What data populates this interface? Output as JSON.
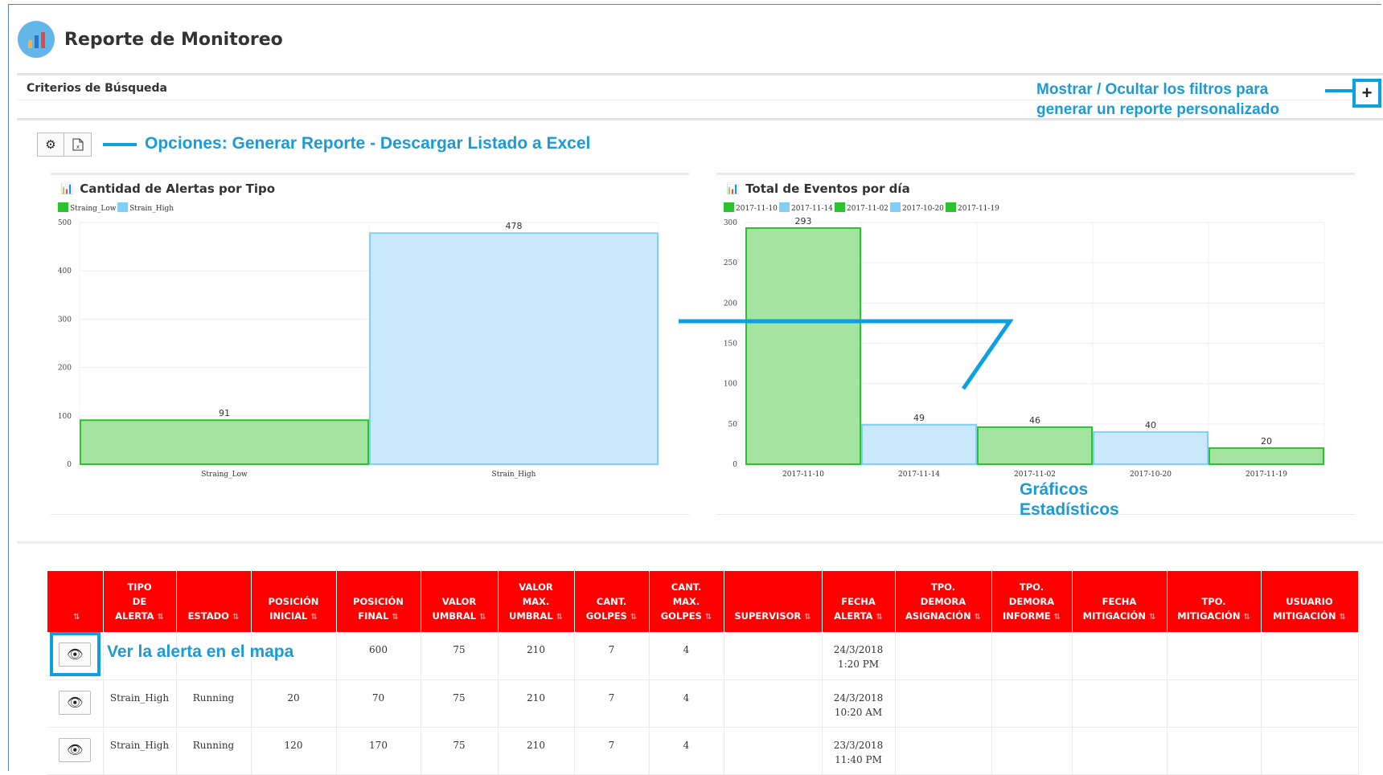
{
  "header": {
    "title": "Reporte de Monitoreo",
    "icon": "bar-chart-icon",
    "icon_color": "#63b6ea"
  },
  "search": {
    "title": "Criterios de Búsqueda",
    "toggle_label": "+"
  },
  "callouts": {
    "filters": [
      "Mostrar / Ocultar los filtros para",
      "generar un reporte personalizado"
    ],
    "options": "Opciones: Generar Reporte - Descargar Listado a Excel",
    "charts": [
      "Gráficos",
      "Estadísticos"
    ],
    "map": "Ver la alerta en el mapa",
    "accent": "#1c9ad6"
  },
  "toolbar": {
    "settings_icon": "gear-icon",
    "excel_icon": "excel-icon"
  },
  "chart_data": [
    {
      "type": "bar",
      "title": "Cantidad de Alertas por Tipo",
      "categories": [
        "Straing_Low",
        "Strain_High"
      ],
      "values": [
        91,
        478
      ],
      "legend": [
        "Straing_Low",
        "Strain_High"
      ],
      "colors": [
        "#a3e4a0",
        "#c9e8fb"
      ],
      "stroke_colors": [
        "#2bc22b",
        "#7fcff7"
      ],
      "ylim": [
        0,
        500
      ],
      "yticks": [
        0,
        100,
        200,
        300,
        400,
        500
      ],
      "legend_placement": "top-left",
      "grid": true
    },
    {
      "type": "bar",
      "title": "Total de Eventos por día",
      "categories": [
        "2017-11-10",
        "2017-11-14",
        "2017-11-02",
        "2017-10-20",
        "2017-11-19"
      ],
      "values": [
        293,
        49,
        46,
        40,
        20
      ],
      "legend": [
        "2017-11-10",
        "2017-11-14",
        "2017-11-02",
        "2017-10-20",
        "2017-11-19"
      ],
      "colors": [
        "#a3e4a0",
        "#c9e8fb",
        "#a3e4a0",
        "#c9e8fb",
        "#a3e4a0"
      ],
      "stroke_colors": [
        "#2bc22b",
        "#7fcff7",
        "#2bc22b",
        "#7fcff7",
        "#2bc22b"
      ],
      "ylim": [
        0,
        300
      ],
      "yticks": [
        0,
        50,
        100,
        150,
        200,
        250,
        300
      ],
      "legend_placement": "top-left",
      "grid": true
    }
  ],
  "table": {
    "header_color": "#ff0000",
    "columns": [
      [
        ""
      ],
      [
        "TIPO",
        "DE",
        "ALERTA"
      ],
      [
        "ESTADO"
      ],
      [
        "POSICIÓN",
        "INICIAL"
      ],
      [
        "POSICIÓN",
        "FINAL"
      ],
      [
        "VALOR",
        "UMBRAL"
      ],
      [
        "VALOR",
        "MAX.",
        "UMBRAL"
      ],
      [
        "CANT.",
        "GOLPES"
      ],
      [
        "CANT.",
        "MAX.",
        "GOLPES"
      ],
      [
        "SUPERVISOR"
      ],
      [
        "FECHA",
        "ALERTA"
      ],
      [
        "TPO.",
        "DEMORA",
        "ASIGNACIÓN"
      ],
      [
        "TPO.",
        "DEMORA",
        "INFORME"
      ],
      [
        "FECHA",
        "MITIGACIÓN"
      ],
      [
        "TPO.",
        "MITIGACIÓN"
      ],
      [
        "USUARIO",
        "MITIGACIÓN"
      ]
    ],
    "rows": [
      [
        "",
        "",
        "",
        "",
        "600",
        "75",
        "210",
        "7",
        "4",
        "",
        "24/3/2018\n1:20 PM",
        "",
        "",
        "",
        "",
        ""
      ],
      [
        "",
        "Strain_High",
        "Running",
        "20",
        "70",
        "75",
        "210",
        "7",
        "4",
        "",
        "24/3/2018\n10:20 AM",
        "",
        "",
        "",
        "",
        ""
      ],
      [
        "",
        "Strain_High",
        "Running",
        "120",
        "170",
        "75",
        "210",
        "7",
        "4",
        "",
        "23/3/2018\n11:40 PM",
        "",
        "",
        "",
        "",
        ""
      ]
    ],
    "row_icon": "eye-icon"
  }
}
